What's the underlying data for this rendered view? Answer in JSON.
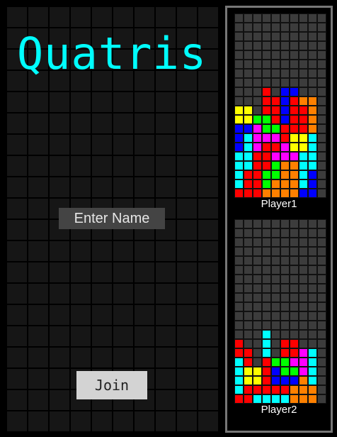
{
  "game": {
    "title": "Quatris",
    "name_input": {
      "placeholder": "Enter Name",
      "value": ""
    },
    "join_label": "Join"
  },
  "palette": {
    ".": "#3c3c3c",
    "R": "#ff0000",
    "Y": "#ffff00",
    "G": "#00ff00",
    "B": "#0000ff",
    "M": "#ff00ff",
    "C": "#00ffff",
    "O": "#ff8000"
  },
  "players": [
    {
      "label": "Player1",
      "rows": [
        "..........",
        "..........",
        "..........",
        "..........",
        "..........",
        "..........",
        "..........",
        "..........",
        "..........",
        "...R.BB...",
        "...RRBROO.",
        "YY.RRBRRO.",
        "YYGGRBRRO.",
        "BBMGGRRRO.",
        "BCMMMRYYC.",
        "BCMRRMYYC.",
        "CCRRMMMCC.",
        "CCRRGOOCC.",
        "CRRGGOOCB.",
        "CRRGOOOCB.",
        "RRROOOOBB."
      ]
    },
    {
      "label": "Player2",
      "rows": [
        "..........",
        "..........",
        "..........",
        "..........",
        "..........",
        "..........",
        "..........",
        "..........",
        "..........",
        "...C......",
        "R..C.RR...",
        "RR.C.RRMC.",
        "CR.RGGMMC.",
        "CYYRBGGMC.",
        "CYYRBBBOC.",
        "CRRRRROOO.",
        "RRCCCCOOO."
      ]
    }
  ]
}
